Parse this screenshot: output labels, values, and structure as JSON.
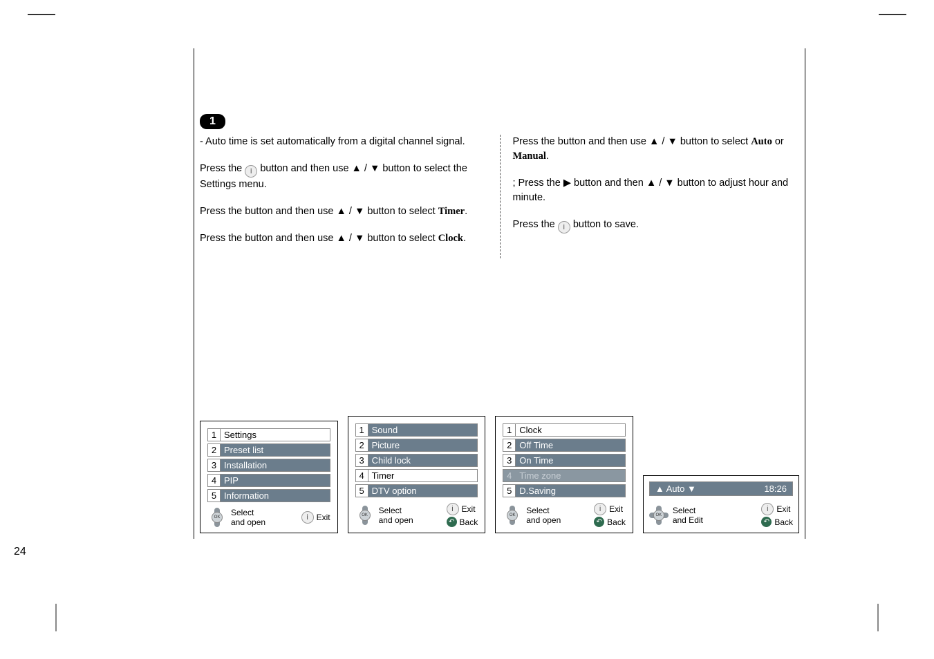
{
  "step": "1",
  "left": {
    "intro": "- Auto time is set automatically from a digital channel signal.",
    "p1_a": "Press the ",
    "p1_b": " button and then use ▲ / ▼ button to select the Settings menu.",
    "p2_a": "Press the ",
    "p2_b": " button and then use ▲ / ▼ button to select ",
    "p2_bold": "Timer",
    "p3_a": "Press the ",
    "p3_b": " button and then use ▲ / ▼ button to select ",
    "p3_bold": "Clock"
  },
  "right": {
    "p1_a": "Press the ",
    "p1_b": " button and then use ▲ / ▼ button to select ",
    "p1_bold": "Auto",
    "p1_or": " or ",
    "p1_bold2": "Manual",
    "p2": "; Press the ▶ button and then ▲ / ▼ button to adjust hour and minute.",
    "p3_a": "Press the ",
    "p3_b": " button to save."
  },
  "menus": {
    "panel1": {
      "items": [
        {
          "n": "1",
          "l": "Settings",
          "sel": true
        },
        {
          "n": "2",
          "l": "Preset list"
        },
        {
          "n": "3",
          "l": "Installation"
        },
        {
          "n": "4",
          "l": "PIP"
        },
        {
          "n": "5",
          "l": "Information"
        }
      ],
      "f_select": "Select",
      "f_open": "and open",
      "f_exit": "Exit"
    },
    "panel2": {
      "items": [
        {
          "n": "1",
          "l": "Sound"
        },
        {
          "n": "2",
          "l": "Picture"
        },
        {
          "n": "3",
          "l": "Child lock"
        },
        {
          "n": "4",
          "l": "Timer",
          "sel": true
        },
        {
          "n": "5",
          "l": "DTV option"
        }
      ],
      "f_select": "Select",
      "f_open": "and open",
      "f_exit": "Exit",
      "f_back": "Back"
    },
    "panel3": {
      "items": [
        {
          "n": "1",
          "l": "Clock",
          "sel": true
        },
        {
          "n": "2",
          "l": "Off Time"
        },
        {
          "n": "3",
          "l": "On Time"
        },
        {
          "n": "4",
          "l": "Time zone",
          "dim": true
        },
        {
          "n": "5",
          "l": "D.Saving"
        }
      ],
      "f_select": "Select",
      "f_open": "and open",
      "f_exit": "Exit",
      "f_back": "Back"
    },
    "panel4": {
      "field_label": "▲ Auto ▼",
      "field_value": "18:26",
      "f_select": "Select",
      "f_edit": "and Edit",
      "f_exit": "Exit",
      "f_back": "Back"
    }
  },
  "page_number": "24"
}
